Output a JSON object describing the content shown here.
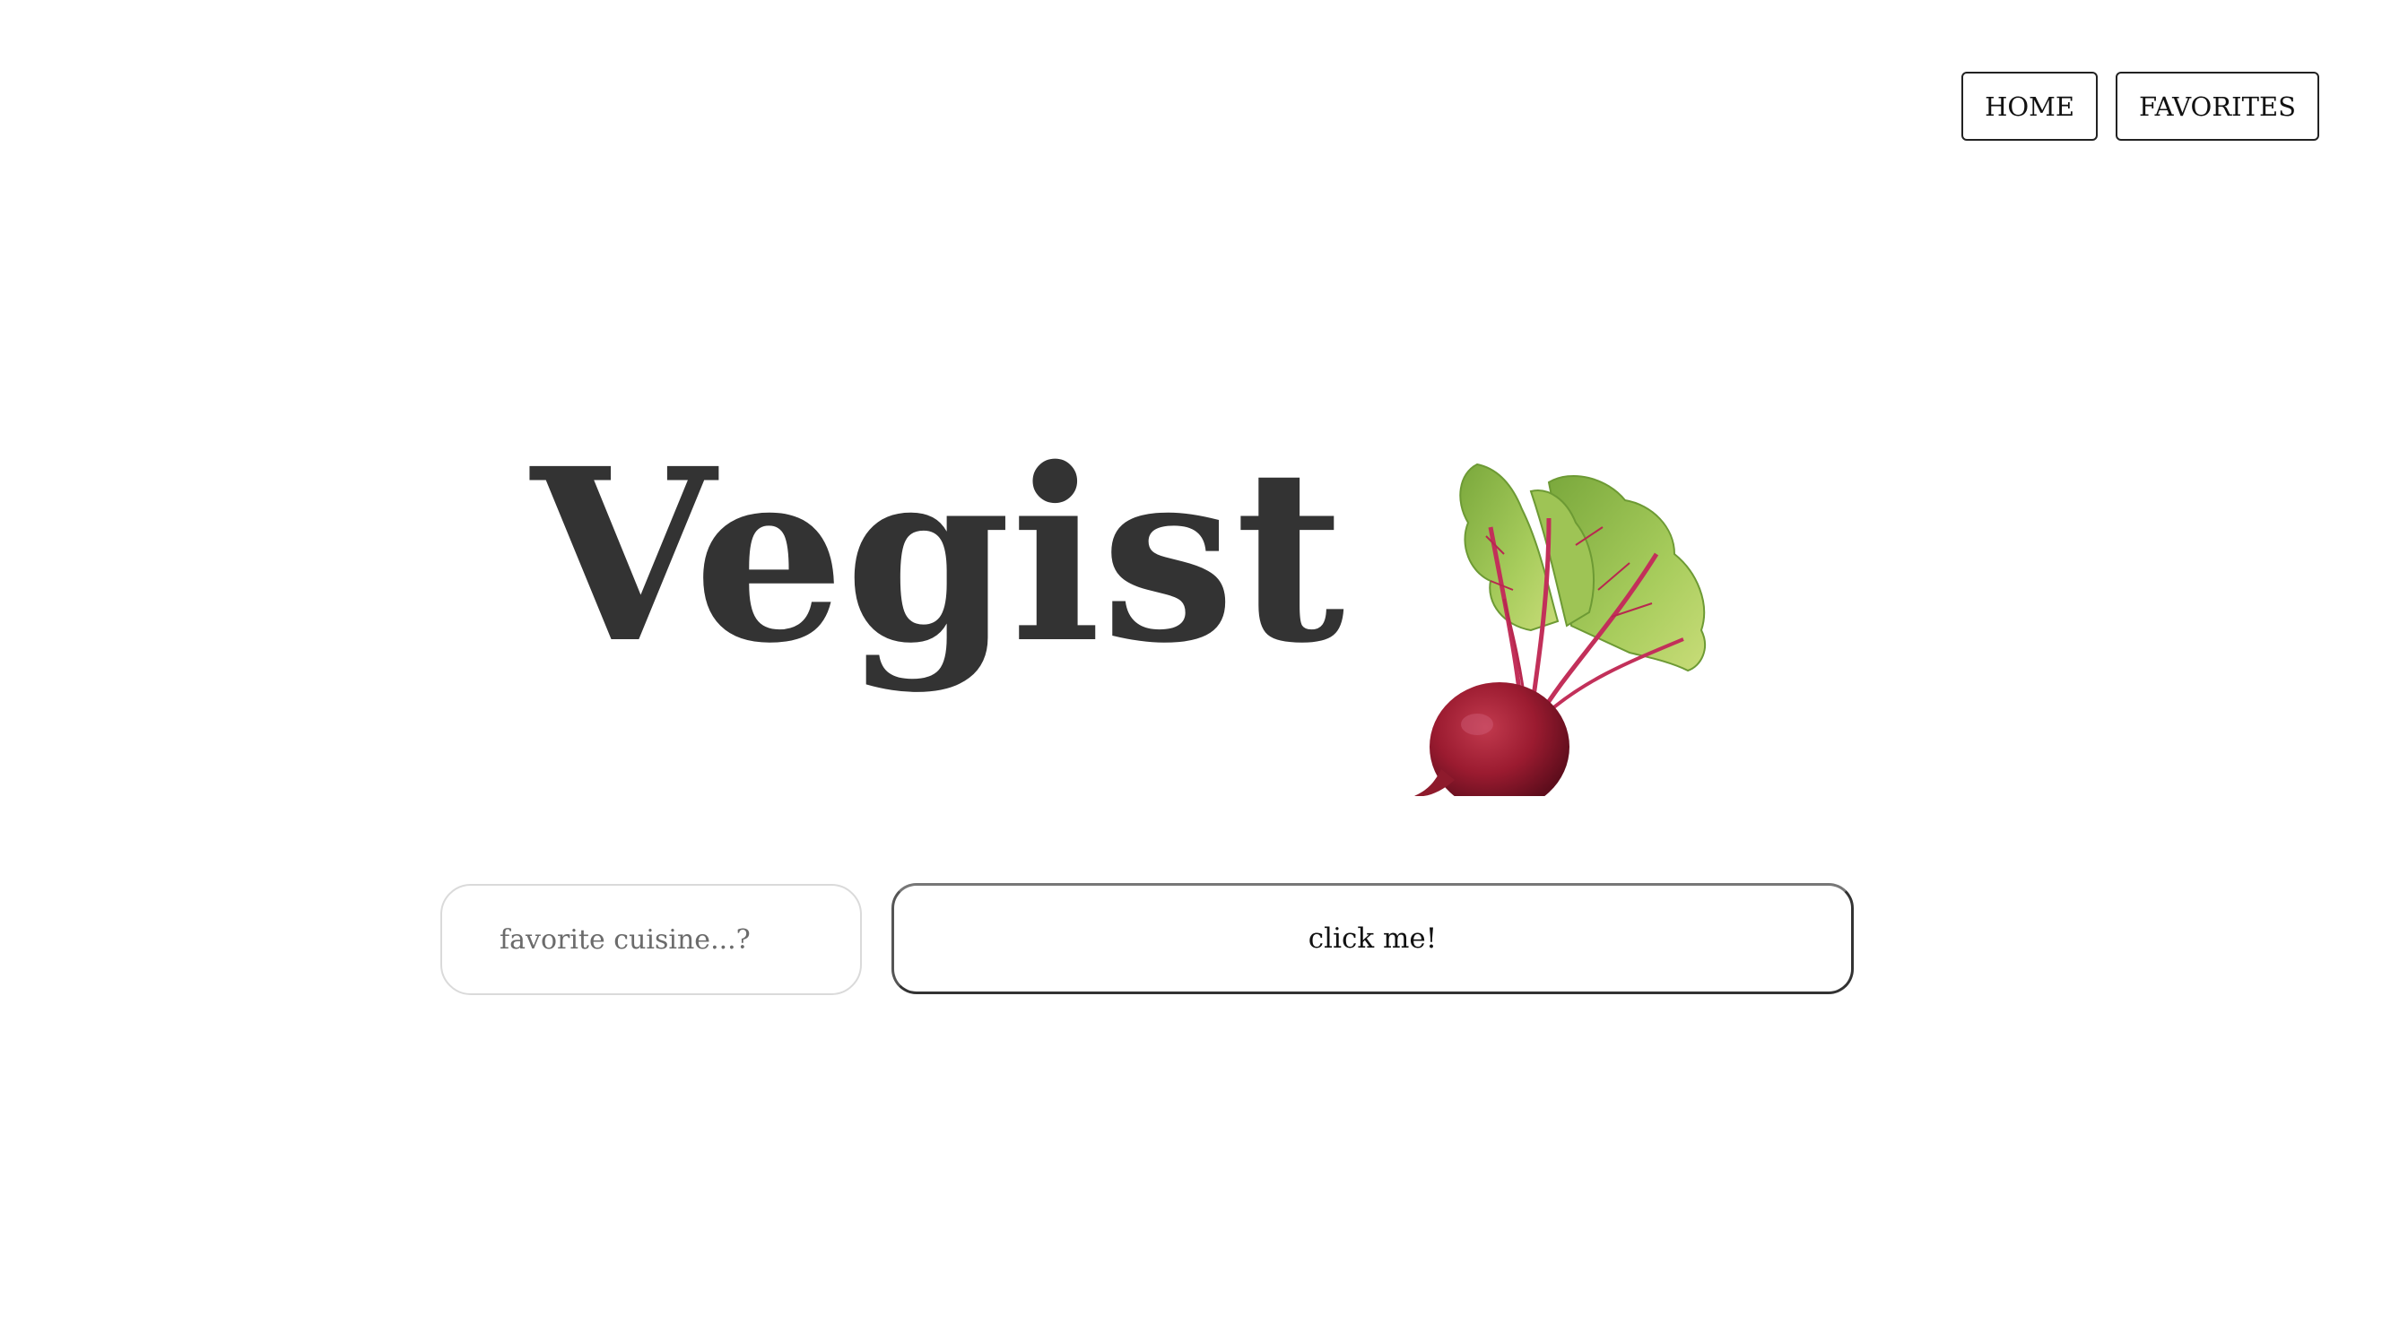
{
  "nav": {
    "home_label": "HOME",
    "favorites_label": "FAVORITES"
  },
  "hero": {
    "title": "Vegist",
    "image": "beetroot-illustration"
  },
  "search": {
    "placeholder": "favorite cuisine...?",
    "value": ""
  },
  "submit": {
    "label": "click me!"
  },
  "colors": {
    "title": "#333333",
    "border": "#222222",
    "beet_root": "#9b1b30",
    "beet_leaf": "#8fbf4a"
  }
}
